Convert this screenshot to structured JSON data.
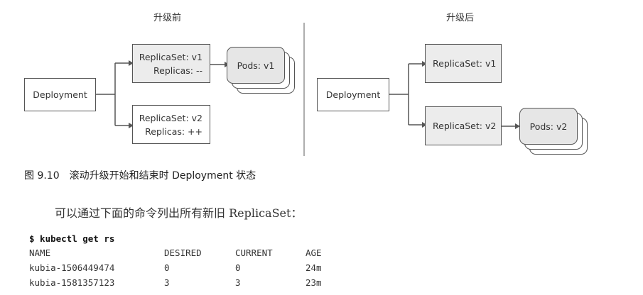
{
  "figure": {
    "left": {
      "title": "升级前",
      "deployment": "Deployment",
      "rs_v1": {
        "line1": "ReplicaSet: v1",
        "line2": "Replicas: --"
      },
      "rs_v2": {
        "line1": "ReplicaSet: v2",
        "line2": "Replicas: ++"
      },
      "pods": "Pods: v1"
    },
    "right": {
      "title": "升级后",
      "deployment": "Deployment",
      "rs_v1": "ReplicaSet: v1",
      "rs_v2": "ReplicaSet: v2",
      "pods": "Pods: v2"
    },
    "caption": "图 9.10　滚动升级开始和结束时 Deployment 状态"
  },
  "paragraph": "可以通过下面的命令列出所有新旧 ReplicaSet：",
  "terminal": {
    "command": "$ kubectl get rs",
    "headers": [
      "NAME",
      "DESIRED",
      "CURRENT",
      "AGE"
    ],
    "rows": [
      [
        "kubia-1506449474",
        "0",
        "0",
        "24m"
      ],
      [
        "kubia-1581357123",
        "3",
        "3",
        "23m"
      ]
    ]
  }
}
